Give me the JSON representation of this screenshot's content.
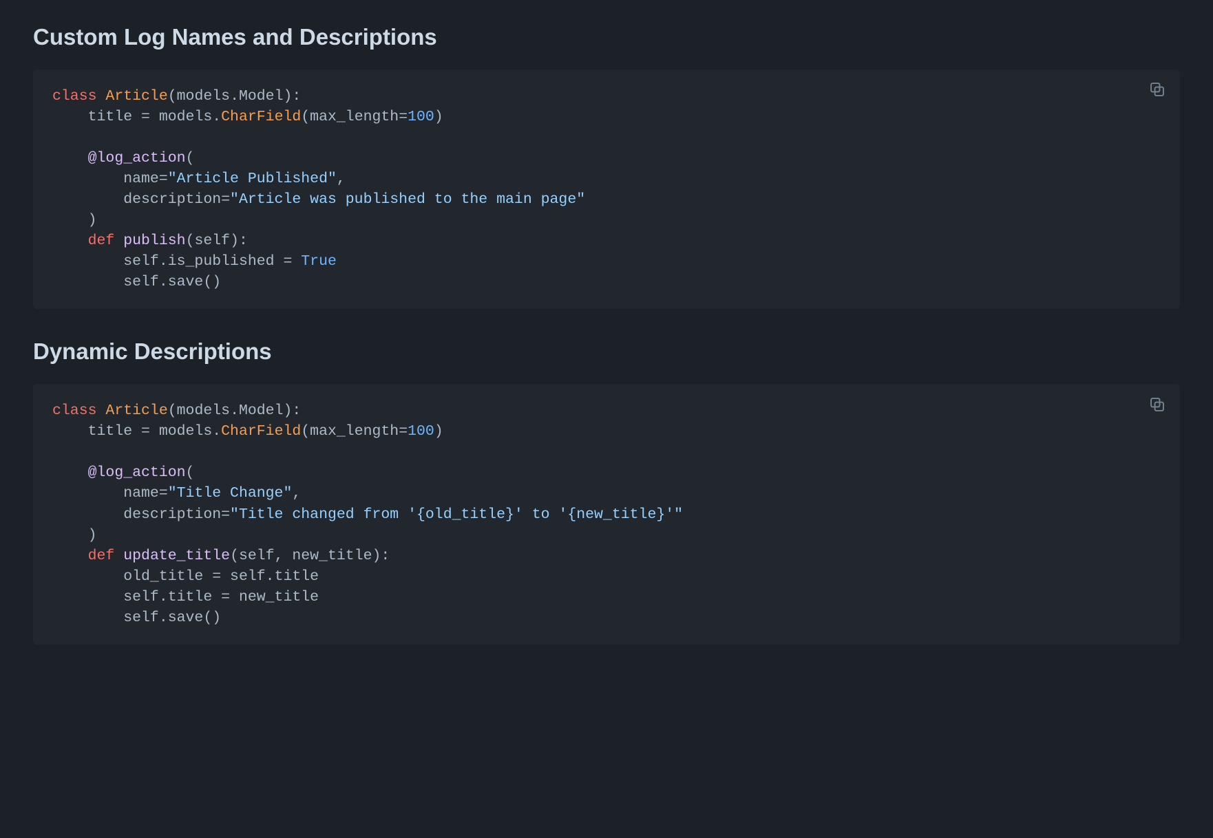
{
  "sections": [
    {
      "title": "Custom Log Names and Descriptions",
      "code": {
        "tokens": [
          [
            [
              "kw",
              "class"
            ],
            [
              "punc",
              " "
            ],
            [
              "cls",
              "Article"
            ],
            [
              "punc",
              "(models.Model):"
            ]
          ],
          [
            [
              "punc",
              "    title "
            ],
            [
              "punc",
              "="
            ],
            [
              "punc",
              " models."
            ],
            [
              "cls",
              "CharField"
            ],
            [
              "punc",
              "(max_length"
            ],
            [
              "punc",
              "="
            ],
            [
              "num",
              "100"
            ],
            [
              "punc",
              ")"
            ]
          ],
          [
            [
              "punc",
              ""
            ]
          ],
          [
            [
              "punc",
              "    "
            ],
            [
              "dec",
              "@log_action"
            ],
            [
              "punc",
              "("
            ]
          ],
          [
            [
              "punc",
              "        name"
            ],
            [
              "punc",
              "="
            ],
            [
              "str",
              "\"Article Published\""
            ],
            [
              "punc",
              ","
            ]
          ],
          [
            [
              "punc",
              "        description"
            ],
            [
              "punc",
              "="
            ],
            [
              "str",
              "\"Article was published to the main page\""
            ]
          ],
          [
            [
              "punc",
              "    )"
            ]
          ],
          [
            [
              "punc",
              "    "
            ],
            [
              "kw",
              "def"
            ],
            [
              "punc",
              " "
            ],
            [
              "fn",
              "publish"
            ],
            [
              "punc",
              "(self):"
            ]
          ],
          [
            [
              "punc",
              "        self.is_published "
            ],
            [
              "punc",
              "="
            ],
            [
              "punc",
              " "
            ],
            [
              "num",
              "True"
            ]
          ],
          [
            [
              "punc",
              "        self.save()"
            ]
          ]
        ]
      }
    },
    {
      "title": "Dynamic Descriptions",
      "code": {
        "tokens": [
          [
            [
              "kw",
              "class"
            ],
            [
              "punc",
              " "
            ],
            [
              "cls",
              "Article"
            ],
            [
              "punc",
              "(models.Model):"
            ]
          ],
          [
            [
              "punc",
              "    title "
            ],
            [
              "punc",
              "="
            ],
            [
              "punc",
              " models."
            ],
            [
              "cls",
              "CharField"
            ],
            [
              "punc",
              "(max_length"
            ],
            [
              "punc",
              "="
            ],
            [
              "num",
              "100"
            ],
            [
              "punc",
              ")"
            ]
          ],
          [
            [
              "punc",
              ""
            ]
          ],
          [
            [
              "punc",
              "    "
            ],
            [
              "dec",
              "@log_action"
            ],
            [
              "punc",
              "("
            ]
          ],
          [
            [
              "punc",
              "        name"
            ],
            [
              "punc",
              "="
            ],
            [
              "str",
              "\"Title Change\""
            ],
            [
              "punc",
              ","
            ]
          ],
          [
            [
              "punc",
              "        description"
            ],
            [
              "punc",
              "="
            ],
            [
              "str",
              "\"Title changed from '{old_title}' to '{new_title}'\""
            ]
          ],
          [
            [
              "punc",
              "    )"
            ]
          ],
          [
            [
              "punc",
              "    "
            ],
            [
              "kw",
              "def"
            ],
            [
              "punc",
              " "
            ],
            [
              "fn",
              "update_title"
            ],
            [
              "punc",
              "(self, new_title):"
            ]
          ],
          [
            [
              "punc",
              "        old_title "
            ],
            [
              "punc",
              "="
            ],
            [
              "punc",
              " self.title"
            ]
          ],
          [
            [
              "punc",
              "        self.title "
            ],
            [
              "punc",
              "="
            ],
            [
              "punc",
              " new_title"
            ]
          ],
          [
            [
              "punc",
              "        self.save()"
            ]
          ]
        ]
      }
    }
  ],
  "icons": {
    "copy": "copy-icon"
  }
}
